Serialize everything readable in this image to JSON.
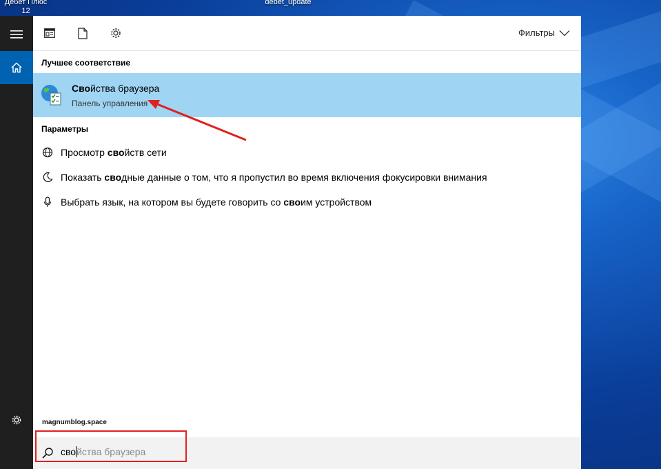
{
  "desktop": {
    "icon_label_line1": "Дебет Плюс",
    "icon_label_line2": "12",
    "icon2_label": "debet_update"
  },
  "rail": {
    "items": [
      "menu-icon",
      "home-icon",
      "settings-icon"
    ]
  },
  "toolbar": {
    "icons": [
      "apps-icon",
      "document-icon",
      "settings-icon"
    ],
    "filters_label": "Фильтры"
  },
  "best_match": {
    "section_title": "Лучшее соответствие",
    "title_bold": "Сво",
    "title_rest": "йства браузера",
    "subtitle": "Панель управления",
    "icon": "internet-options-icon"
  },
  "settings": {
    "section_title": "Параметры",
    "items": [
      {
        "icon": "globe-icon",
        "pre": "Просмотр ",
        "bold": "сво",
        "post": "йств сети"
      },
      {
        "icon": "moon-icon",
        "pre": "Показать ",
        "bold": "сво",
        "post": "дные данные о том, что я пропустил во время включения фокусировки внимания"
      },
      {
        "icon": "microphone-icon",
        "pre": "Выбрать язык, на котором вы будете говорить со ",
        "bold": "сво",
        "post": "им устройством"
      }
    ]
  },
  "footer": {
    "site": "magnumblog.space"
  },
  "search": {
    "typed": "сво",
    "suggestion": "йства браузера"
  },
  "colors": {
    "highlight": "#9fd4f3",
    "rail": "#1f1f1f",
    "rail_active": "#0063b1",
    "annotation": "#e02020"
  }
}
